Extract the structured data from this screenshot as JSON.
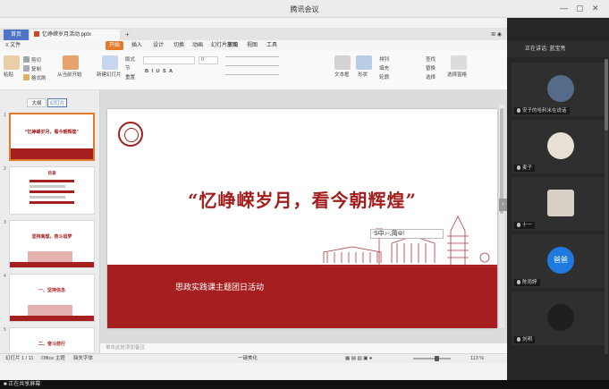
{
  "window": {
    "title": "腾讯会议",
    "minimize": "—",
    "maximize": "▢",
    "close": "✕"
  },
  "wps": {
    "tabs": {
      "home": "首页",
      "file": "忆峥嵘岁月活动.pptx",
      "plus": "+",
      "right": "⊞ ◉"
    },
    "menu": {
      "file": "≡ 文件",
      "start": "开始",
      "insert": "插入",
      "design": "设计",
      "switch": "切换",
      "animation": "动画",
      "slideshow": "幻灯片放映",
      "review": "审阅",
      "view": "视图",
      "tools": "工具"
    },
    "ribbon": {
      "paste": "粘贴",
      "cut": "剪切",
      "copy": "复制",
      "format_painter": "格式刷",
      "from_current": "从当前开始",
      "new_slide": "新建幻灯片",
      "layout": "版式",
      "section": "节",
      "reset": "重置",
      "font_box": "",
      "size_box": "0",
      "bold_row": "B  I  U  S  A",
      "text_box": "文本框",
      "shapes": "形状",
      "arrange": "排列",
      "fill": "填充",
      "outline": "轮廓",
      "find": "查找",
      "replace": "替换",
      "select": "选择",
      "select_pane": "选择窗格"
    },
    "pane": {
      "outline_tab": "大纲",
      "slides_tab": "幻灯片"
    },
    "thumbs": [
      {
        "num": "1",
        "title": "“忆峥嵘岁月，看今朝辉煌”"
      },
      {
        "num": "2",
        "title": "目录"
      },
      {
        "num": "3",
        "title": "坚持真理，奋斗追梦"
      },
      {
        "num": "4",
        "title": "一、坚持信念"
      },
      {
        "num": "5",
        "title": "二、奋斗前行"
      }
    ],
    "slide": {
      "title": "“忆峥嵘岁月，看今朝辉煌”",
      "subtitle": "思政实践课主题团日活动",
      "toolbar": "S中♪◦,简⊜⁝"
    },
    "notes_placeholder": "单击此处添加备注",
    "status": {
      "slide_of": "幻灯片 1 / 11",
      "theme": "Office 主题",
      "missing_font": "缺失字体",
      "beautify": "一键美化",
      "zoom": "113 %",
      "zoom_level": 0.6
    }
  },
  "participants": {
    "header": "正在讲话: 蓝宝亮",
    "tiles": [
      {
        "name": "安子的哈利米在说话",
        "color": "#4a4a4a",
        "avatar": "#556b8a"
      },
      {
        "name": "麦子",
        "color": "#2f2f2f",
        "avatar": "#e6e1d4"
      },
      {
        "name": "十一",
        "color": "#2f2f2f",
        "avatar": "#d8cfc6"
      },
      {
        "name": "陈雨婷",
        "color": "#2f2f2f",
        "avatar": "#1f7ae0",
        "initials": "爸爸"
      },
      {
        "name": "刘明",
        "color": "#2f2f2f",
        "avatar": "#1f1f1f"
      }
    ]
  },
  "meeting": {
    "sharing_label": "■ 正在共享屏幕"
  }
}
